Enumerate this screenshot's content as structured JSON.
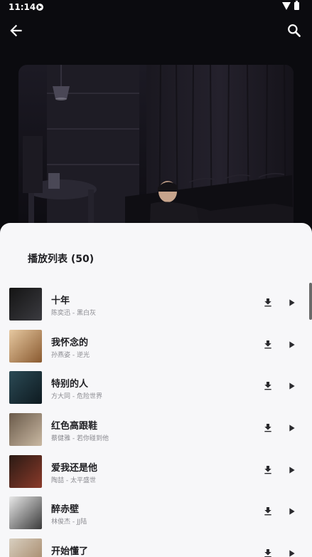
{
  "status_bar": {
    "time": "11:14",
    "icons": [
      "screen-record-icon",
      "wifi-icon",
      "battery-icon"
    ]
  },
  "top_bar": {
    "icons": [
      "back-arrow-icon",
      "search-icon"
    ]
  },
  "playlist": {
    "title": "播放列表 (50)",
    "songs": [
      {
        "title": "十年",
        "subtitle": "陈奕迅 - 黑白灰",
        "thumb_colors": [
          "#141414",
          "#3b3b40"
        ]
      },
      {
        "title": "我怀念的",
        "subtitle": "孙燕姿 - 逆光",
        "thumb_colors": [
          "#e6c8a0",
          "#8a5a30"
        ]
      },
      {
        "title": "特别的人",
        "subtitle": "方大同 - 危险世界",
        "thumb_colors": [
          "#2b4a55",
          "#0e1a20"
        ]
      },
      {
        "title": "红色高跟鞋",
        "subtitle": "蔡健雅 - 若你碰到他",
        "thumb_colors": [
          "#6a5a4a",
          "#c9b8a2"
        ]
      },
      {
        "title": "爱我还是他",
        "subtitle": "陶喆 - 太平盛世",
        "thumb_colors": [
          "#2a1a14",
          "#8a3a2a"
        ]
      },
      {
        "title": "醉赤壁",
        "subtitle": "林俊杰 - JJ陆",
        "thumb_colors": [
          "#e8e8e8",
          "#3a3a3a"
        ]
      },
      {
        "title": "开始懂了",
        "subtitle": "",
        "thumb_colors": [
          "#d8cfc0",
          "#a08060"
        ]
      }
    ]
  },
  "colors": {
    "background": "#0b0b0f",
    "sheet": "#f7f7f9",
    "title_text": "#1e1e22",
    "subtitle_text": "#8a8a90",
    "icon": "#2a2a2e"
  }
}
